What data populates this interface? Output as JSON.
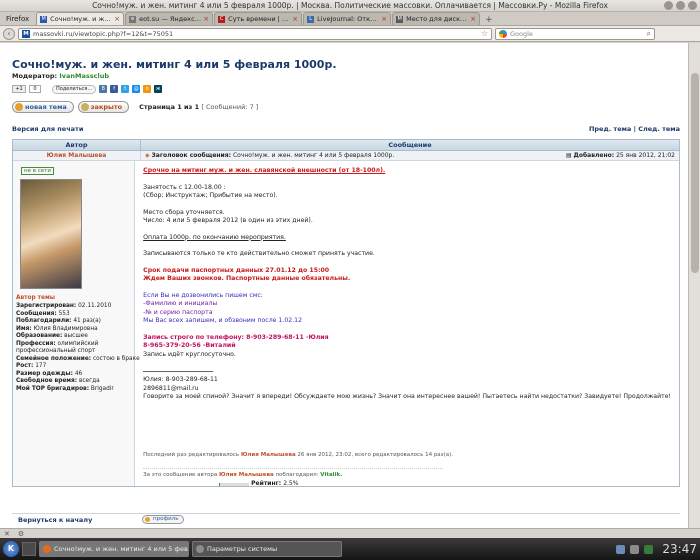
{
  "window": {
    "title": "Сочно!муж. и жен. митинг 4 или 5 февраля 1000р. | Москва. Политические массовки. Оплачивается | Массовки.Ру - Mozilla Firefox"
  },
  "browser": {
    "menu_label": "Firefox",
    "tabs": [
      {
        "label": "Сочно!муж. и жен. митинг 4 или 5 февр...",
        "active": true
      },
      {
        "label": "eot.su — Яндекс: Нашлось 26...",
        "active": false
      },
      {
        "label": "Суть времени | виртуальный ...",
        "active": false
      },
      {
        "label": "LiveJournal: Откройте для се...",
        "active": false
      },
      {
        "label": "Место для дискуссий - После...",
        "active": false
      }
    ],
    "new_tab": "+",
    "url": "massovki.ru/viewtopic.php?f=12&t=75051",
    "search_engine": "Google",
    "search_placeholder": "Google"
  },
  "topic": {
    "title": "Сочно!муж. и жен. митинг 4 или 5 февраля 1000р.",
    "moderator_label": "Модератор:",
    "moderator_name": "IvanMassclub",
    "gplus_label": "+1",
    "gplus_count": "0",
    "share_label": "Поделиться...",
    "social_icons": [
      {
        "name": "vkontakte-icon",
        "glyph": "В",
        "color": "#4a76a8"
      },
      {
        "name": "facebook-icon",
        "glyph": "f",
        "color": "#3b5998"
      },
      {
        "name": "twitter-icon",
        "glyph": "t",
        "color": "#2fa4e7"
      },
      {
        "name": "moi-mir-icon",
        "glyph": "@",
        "color": "#168de2"
      },
      {
        "name": "odnoklassniki-icon",
        "glyph": "о",
        "color": "#f59312"
      },
      {
        "name": "livejournal-icon",
        "glyph": "ж",
        "color": "#004359"
      }
    ],
    "new_topic_label": "новая тема",
    "locked_label": "закрыто",
    "page_label": "Страница 1 из 1",
    "messages_count": "[ Сообщений: 7 ]",
    "print_label": "Версия для печати",
    "prev_topic": "Пред. тема",
    "link_sep": "|",
    "next_topic": "След. тема"
  },
  "table": {
    "author_header": "Автор",
    "message_header": "Сообщение"
  },
  "post": {
    "author_name": "Юлия Малышева",
    "subject_label": "Заголовок сообщения:",
    "subject": "Сочно!муж. и жен. митинг 4 или 5 февраля 1000р.",
    "date_label": "Добавлено:",
    "date": "25 янв 2012, 21:02",
    "online_label": "не в сети",
    "role": "Автор темы",
    "stats": [
      {
        "label": "Зарегистрирован:",
        "value": "02.11.2010"
      },
      {
        "label": "Сообщения:",
        "value": "553"
      },
      {
        "label": "Поблагодарили:",
        "value": "41 раз(а)"
      },
      {
        "label": "Имя:",
        "value": "Юлия Владимировна"
      },
      {
        "label": "Образование:",
        "value": "высшее"
      },
      {
        "label": "Профессия:",
        "value": "олимпийский профессиональный спорт"
      },
      {
        "label": "Семейное положение:",
        "value": "состою в браке"
      },
      {
        "label": "Рост:",
        "value": "177"
      },
      {
        "label": "Размер одежды:",
        "value": "46"
      },
      {
        "label": "Свободное время:",
        "value": "всегда"
      },
      {
        "label": "Мой ТОР бригадиров:",
        "value": "Brigadir"
      }
    ],
    "body": {
      "headline": "Срочно на митинг муж. и жен. славянской внешности (от 18-100л).",
      "l1": "Занятость с 12.00-18.00 :",
      "l2": "(Сбор; Инструктаж; Прибытие на место).",
      "l3": "Место сбора уточняется.",
      "l4": "Число: 4 или 5 февраля 2012 (в один из этих дней).",
      "l5": "Оплата 1000р. по окончанию мероприятия.",
      "l6": "Записываются только те кто действительно сможет принять участие.",
      "l7": "Срок подачи паспортных данных 27.01.12 до 15:00",
      "l8": "Ждем Ваших звонков. Паспортные данные обязательны.",
      "l9": "Если Вы не дозвонились пишем смс:",
      "l10": "-Фамилию и инициалы",
      "l11": "-№ и серию паспорта",
      "l12": "Мы Вас всех запишем, и обзвоним после 1.02.12",
      "l13": "Запись строго по телефону: 8-903-289-68-11 -Юлия",
      "l14": "8-965-379-20-56 -Виталий",
      "l15": "Запись идёт круглосуточно.",
      "sig1": "Юлия: 8-903-289-68-11",
      "sig2": "2896811@mail.ru",
      "sig3": "Говорите за моей спиной? Значит я впереди! Обсуждаете мою жизнь? Значит она интереснее вашей! Пытаетесь найти недостатки? Завидуете! Продолжайте!"
    },
    "edited_prefix": "Последний раз редактировалось",
    "edited_by": "Юлия Малышева",
    "edited_suffix": "26 янв 2012, 23:02, всего редактировалось 14 раз(а).",
    "thanks_prefix": "За это сообщение автора",
    "thanks_author": "Юлия Малышева",
    "thanks_mid": "поблагодарил:",
    "thanks_voter": "Vitalik.",
    "rating_label": "Рейтинг:",
    "rating_value": "2.5%",
    "rating_fraction": 0.025
  },
  "footer": {
    "back_label": "Вернуться к началу",
    "profile_label": "профиль"
  },
  "taskbar": {
    "items": [
      {
        "label": "Сочно!муж. и жен. митинг 4 или 5 февра",
        "active": true
      },
      {
        "label": "Параметры системы",
        "active": false
      }
    ],
    "clock": "23:47"
  }
}
